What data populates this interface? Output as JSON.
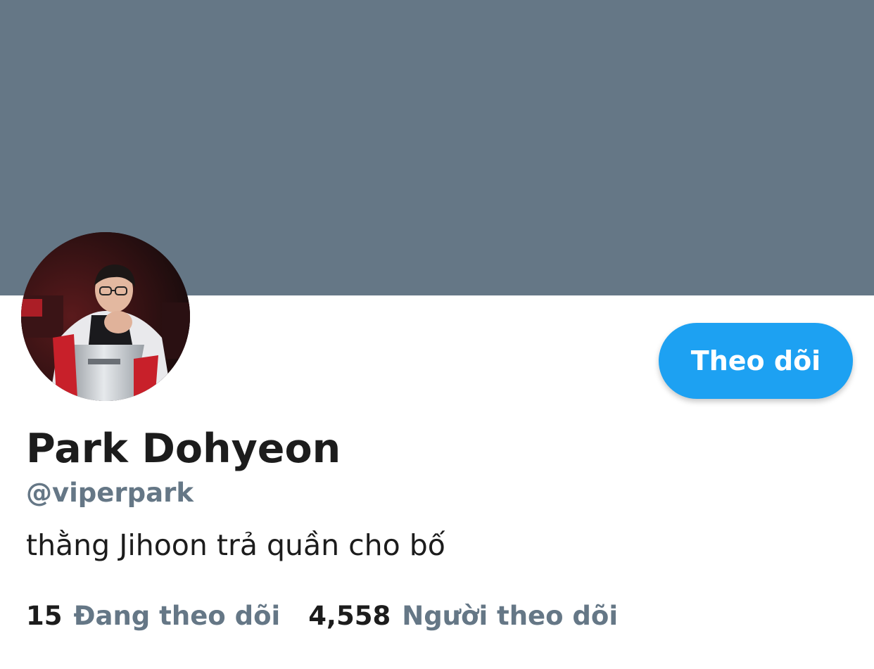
{
  "profile": {
    "display_name": "Park Dohyeon",
    "handle": "@viperpark",
    "bio": "thằng Jihoon trả quần cho bố",
    "avatar_alt": "profile photo"
  },
  "actions": {
    "follow_label": "Theo dõi"
  },
  "stats": {
    "following_count": "15",
    "following_label": "Đang theo dõi",
    "followers_count": "4,558",
    "followers_label": "Người theo dõi"
  },
  "colors": {
    "banner": "#657786",
    "accent": "#1da1f2",
    "secondary_text": "#657786",
    "primary_text": "#1c1c1c"
  }
}
